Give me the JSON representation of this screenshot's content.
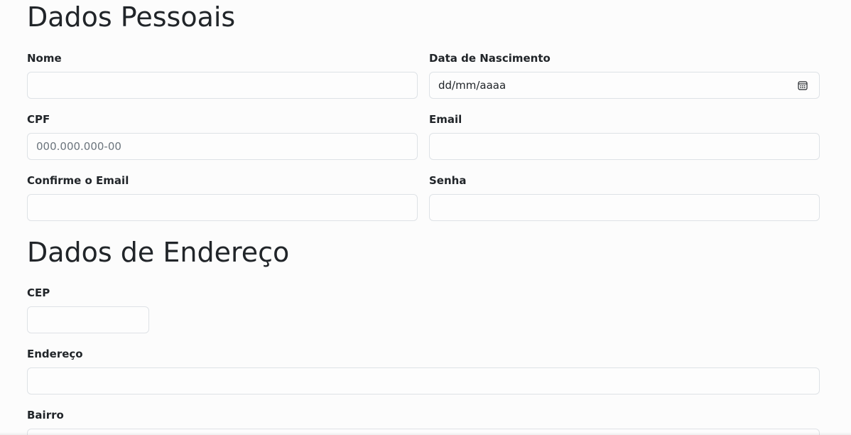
{
  "sections": {
    "personal_title": "Dados Pessoais",
    "address_title": "Dados de Endereço"
  },
  "fields": {
    "nome": {
      "label": "Nome",
      "value": "",
      "placeholder": ""
    },
    "data_nascimento": {
      "label": "Data de Nascimento",
      "display": "dd/mm/aaaa",
      "icon": "calendar-icon"
    },
    "cpf": {
      "label": "CPF",
      "value": "",
      "placeholder": "000.000.000-00"
    },
    "email": {
      "label": "Email",
      "value": "",
      "placeholder": ""
    },
    "confirme_email": {
      "label": "Confirme o Email",
      "value": "",
      "placeholder": ""
    },
    "senha": {
      "label": "Senha",
      "value": "",
      "placeholder": ""
    },
    "cep": {
      "label": "CEP",
      "value": "",
      "placeholder": ""
    },
    "endereco": {
      "label": "Endereço",
      "value": "",
      "placeholder": ""
    },
    "bairro": {
      "label": "Bairro",
      "value": "",
      "placeholder": ""
    }
  },
  "colors": {
    "background": "#fcfcfc",
    "text": "#212529",
    "input_border": "#dee2e6",
    "placeholder": "#6c757d"
  }
}
